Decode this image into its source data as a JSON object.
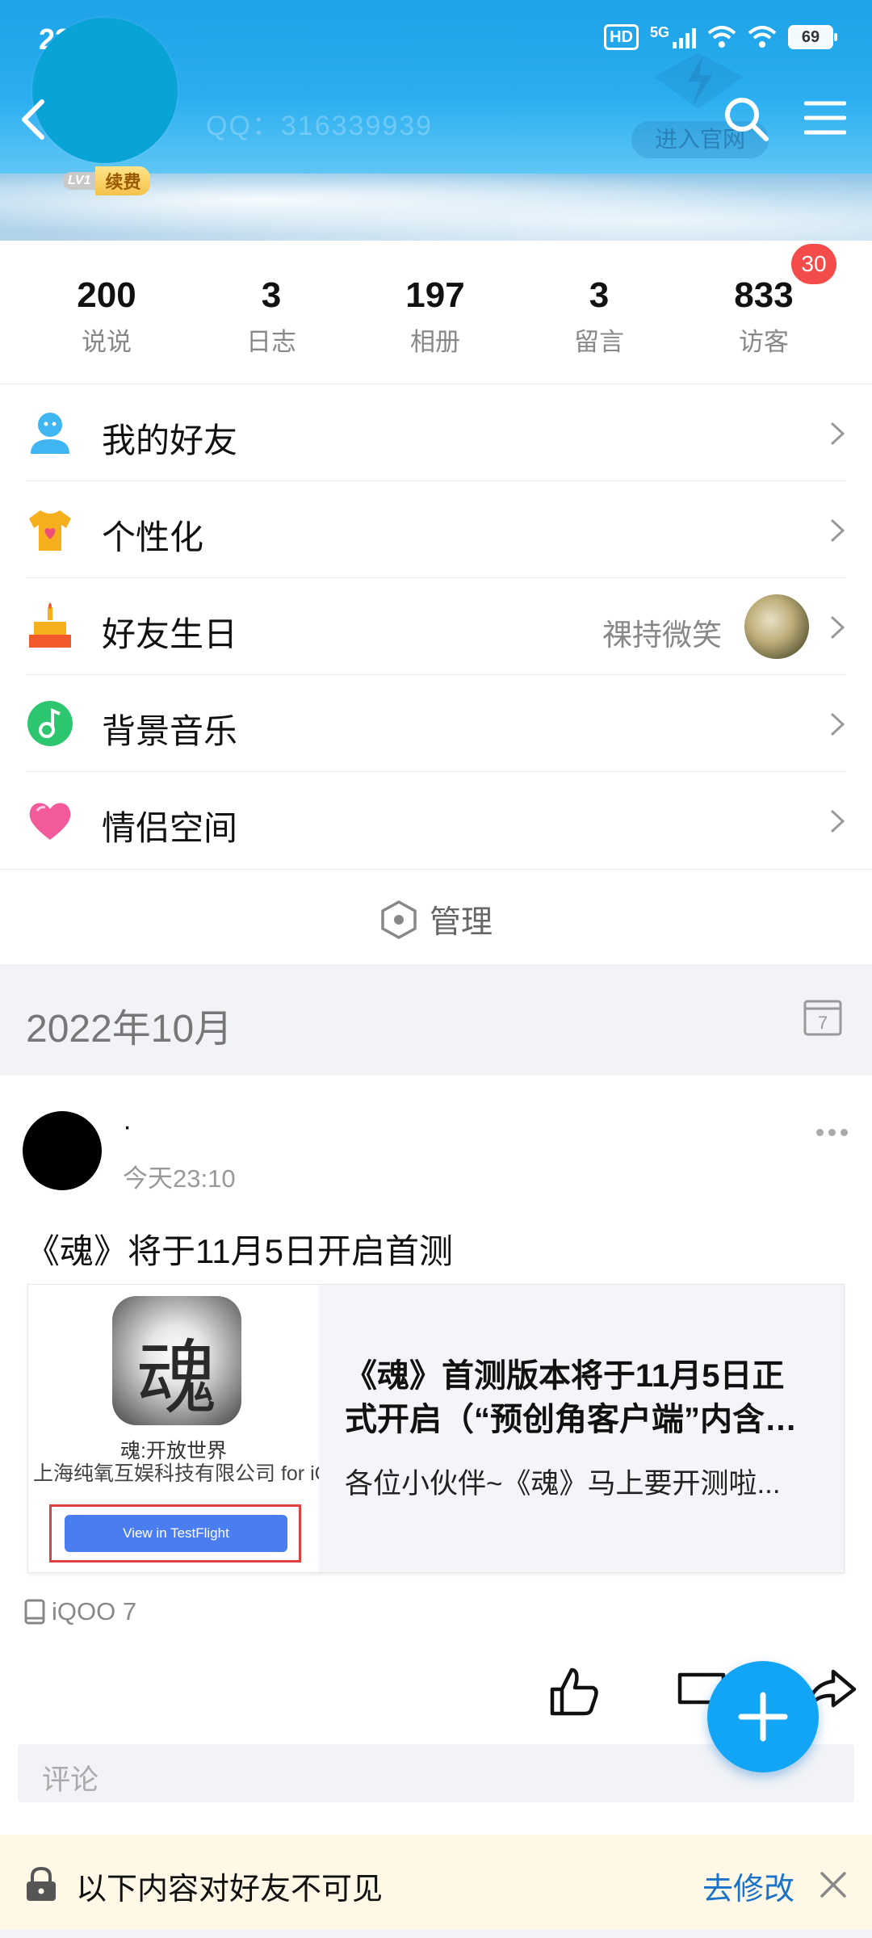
{
  "status_bar": {
    "time": "23:10",
    "hd": "HD",
    "network": "5G",
    "battery": "69"
  },
  "header": {
    "qq_number": "QQ：316339939",
    "level": "LV1",
    "renew_badge": "续费",
    "enter_site": "进入官网"
  },
  "stats": [
    {
      "value": "200",
      "label": "说说"
    },
    {
      "value": "3",
      "label": "日志"
    },
    {
      "value": "197",
      "label": "相册"
    },
    {
      "value": "3",
      "label": "留言"
    },
    {
      "value": "833",
      "label": "访客"
    }
  ],
  "visitor_badge": "30",
  "menu": [
    {
      "label": "我的好友",
      "icon": "friends-icon"
    },
    {
      "label": "个性化",
      "icon": "tshirt-icon"
    },
    {
      "label": "好友生日",
      "icon": "cake-icon",
      "extra": "祼持微笑"
    },
    {
      "label": "背景音乐",
      "icon": "music-icon"
    },
    {
      "label": "情侣空间",
      "icon": "heart-icon"
    }
  ],
  "manage_label": "管理",
  "date_header": "2022年10月",
  "calendar_day": "7",
  "post": {
    "author": "·",
    "time": "今天23:10",
    "text": "《魂》将于11月5日开启首测",
    "card": {
      "app_glyph": "魂",
      "app_name": "魂:开放世界",
      "app_company": "上海纯氧互娱科技有限公司 for iOS",
      "testflight_button": "View in TestFlight",
      "title_line1": "《魂》首测版本将于11月5日正",
      "title_line2": "式开启（“预创角客户端”内含…",
      "description": "各位小伙伴~《魂》马上要开测啦..."
    },
    "device": "iQOO 7",
    "comment_placeholder": "评论"
  },
  "notice": {
    "message": "以下内容对好友不可见",
    "edit_label": "去修改"
  },
  "colors": {
    "accent": "#12a5f5",
    "badge_red": "#f44b4b",
    "link_blue": "#1a73c9"
  }
}
